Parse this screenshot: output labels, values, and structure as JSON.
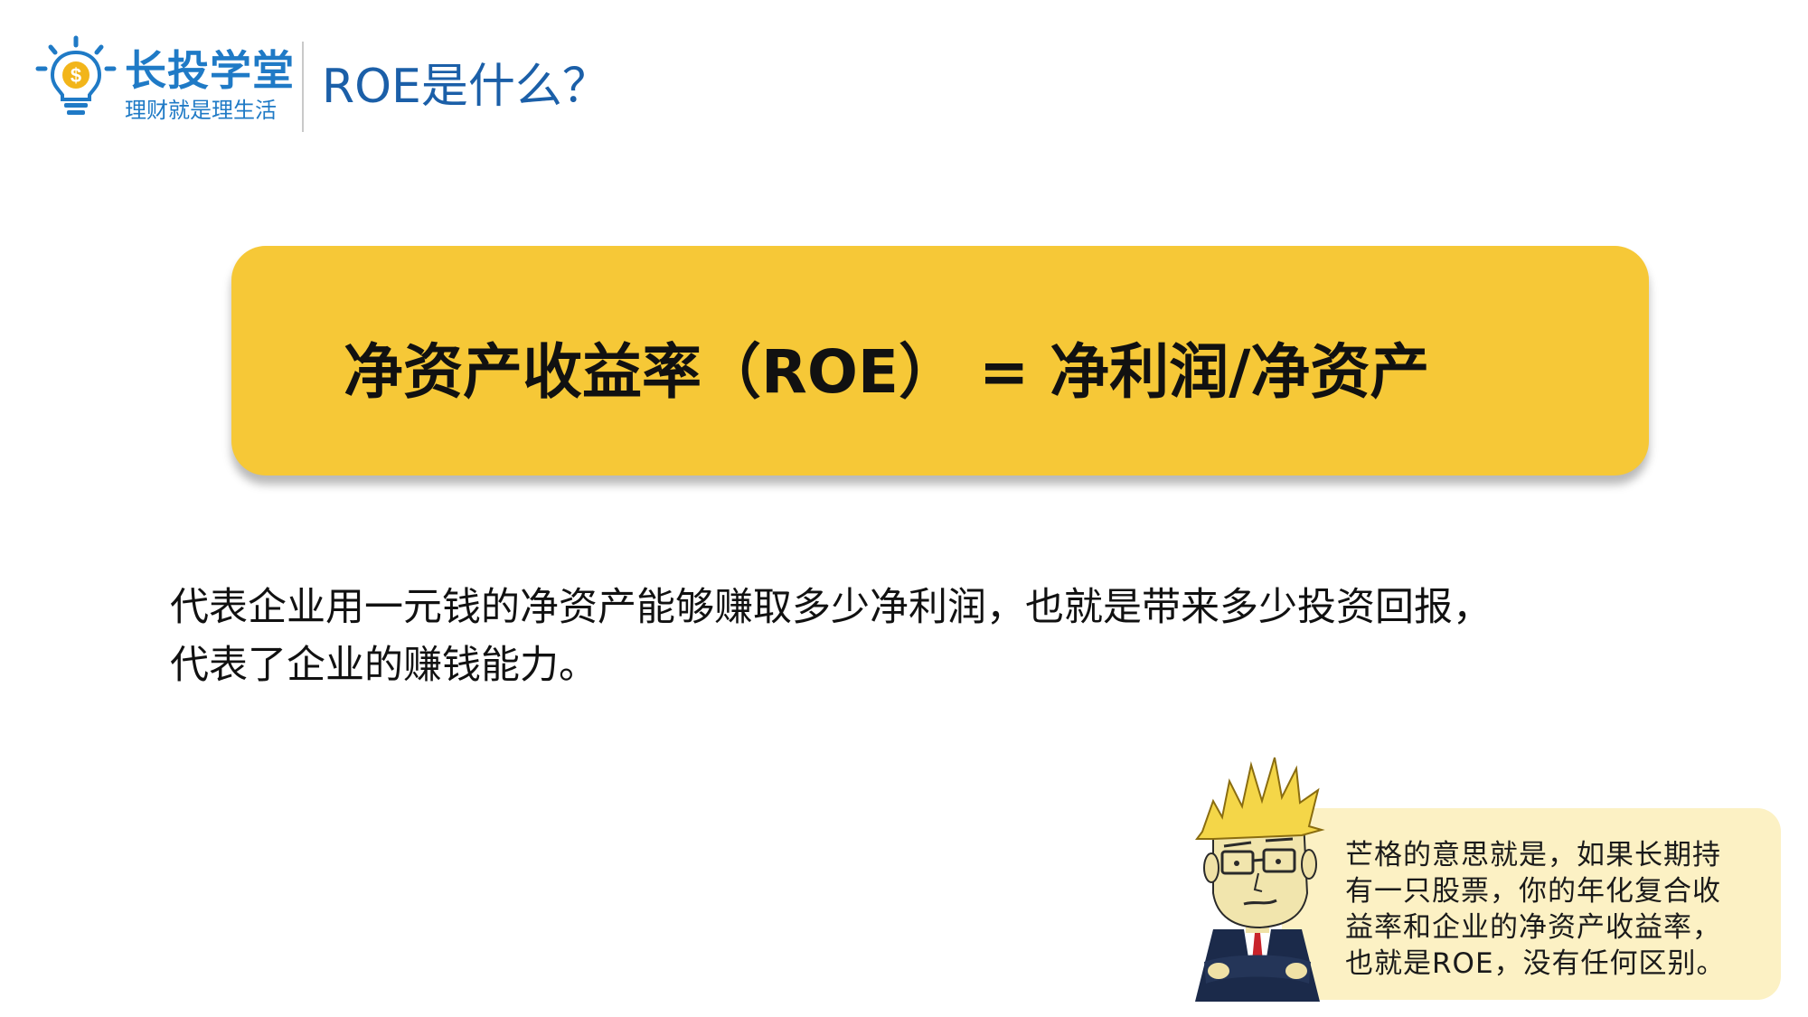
{
  "header": {
    "brand_name": "长投学堂",
    "brand_slogan": "理财就是理生活",
    "title": "ROE是什么？",
    "brand_color": "#1f7ac6",
    "logo_icon": "lightbulb-dollar-icon"
  },
  "formula": {
    "text": "净资产收益率（ROE） = 净利润/净资产",
    "background_color": "#f6c837"
  },
  "description": {
    "line1": "代表企业用一元钱的净资产能够赚取多少净利润，也就是带来多少投资回报，",
    "line2": "代表了企业的赚钱能力。"
  },
  "quote": {
    "line1": "芒格的意思就是，如果长期持",
    "line2": "有一只股票，你的年化复合收",
    "line3": "益率和企业的净资产收益率，",
    "line4": "也就是ROE，没有任何区别。",
    "background_color": "#fcf1c4"
  }
}
